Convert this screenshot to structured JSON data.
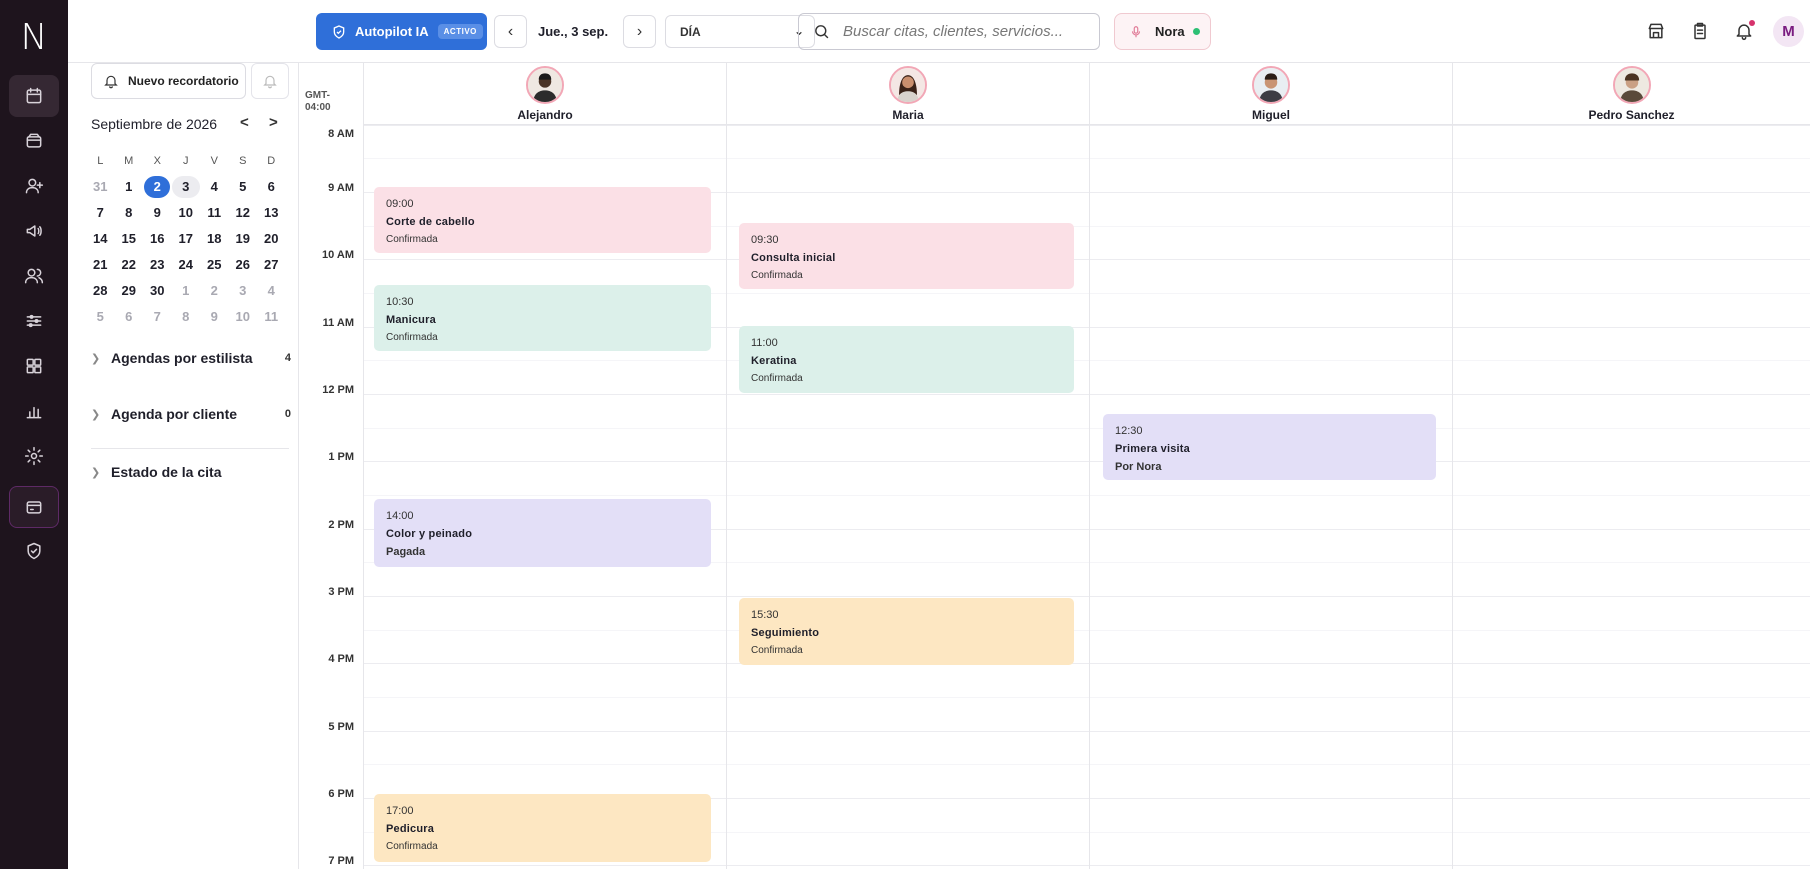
{
  "rail": {
    "logo": "N",
    "items": [
      "calendar-icon",
      "wallet-icon",
      "add-user-icon",
      "megaphone-icon",
      "users-icon",
      "sliders-icon",
      "grid-icon",
      "bar-chart-icon",
      "settings-icon",
      "card-icon",
      "shield-check-icon"
    ]
  },
  "topbar": {
    "autopilot_label": "Autopilot IA",
    "autopilot_badge": "ACTIVO",
    "prev": "‹",
    "next": "›",
    "date": "Jue., 3 sep.",
    "view": "DÍA",
    "search_placeholder": "Buscar citas, clientes, servicios...",
    "assistant": "Nora",
    "user_initial": "M"
  },
  "sidebar": {
    "reminder_button": "Nuevo recordatorio",
    "month_title": "Septiembre de 2026",
    "prev_month": "<",
    "next_month": ">",
    "weekdays": [
      "L",
      "M",
      "X",
      "J",
      "V",
      "S",
      "D"
    ],
    "weeks": [
      [
        "31",
        "1",
        "2",
        "3",
        "4",
        "5",
        "6"
      ],
      [
        "7",
        "8",
        "9",
        "10",
        "11",
        "12",
        "13"
      ],
      [
        "14",
        "15",
        "16",
        "17",
        "18",
        "19",
        "20"
      ],
      [
        "21",
        "22",
        "23",
        "24",
        "25",
        "26",
        "27"
      ],
      [
        "28",
        "29",
        "30",
        "1",
        "2",
        "3",
        "4"
      ],
      [
        "5",
        "6",
        "7",
        "8",
        "9",
        "10",
        "11"
      ]
    ],
    "sections": [
      {
        "label": "Agendas por estilista",
        "count": "4"
      },
      {
        "label": "Agenda por cliente",
        "count": "0"
      },
      {
        "label": "Estado de la cita",
        "count": ""
      }
    ]
  },
  "grid": {
    "timezone_line1": "GMT-",
    "timezone_line2": "04:00",
    "hours": [
      "8 AM",
      "9 AM",
      "10 AM",
      "11 AM",
      "12 PM",
      "1 PM",
      "2 PM",
      "3 PM",
      "4 PM",
      "5 PM",
      "6 PM",
      "7 PM"
    ],
    "stylists": [
      "Alejandro",
      "Maria",
      "Miguel",
      "Pedro Sanchez"
    ],
    "events": [
      {
        "time": "09:00",
        "service": "Corte de cabello",
        "status": "Confirmada"
      },
      {
        "time": "10:30",
        "service": "Manicura",
        "status": "Confirmada"
      },
      {
        "time": "14:00",
        "service": "Color y peinado",
        "status": "Pagada"
      },
      {
        "time": "17:00",
        "service": "Pedicura",
        "status": "Confirmada"
      },
      {
        "time": "09:30",
        "service": "Consulta inicial",
        "status": "Confirmada"
      },
      {
        "time": "11:00",
        "service": "Keratina",
        "status": "Confirmada"
      },
      {
        "time": "15:30",
        "service": "Seguimiento",
        "status": "Confirmada"
      },
      {
        "time": "12:30",
        "service": "Primera visita",
        "status": "Por Nora"
      }
    ]
  },
  "colors": {
    "rail_bg": "#1e141d",
    "accent": "#2f6fd9",
    "event_pink": "#fbe0e6",
    "event_mint": "#dcf0ea",
    "event_lavender": "#e3dff7",
    "event_peach": "#fde7c2"
  }
}
